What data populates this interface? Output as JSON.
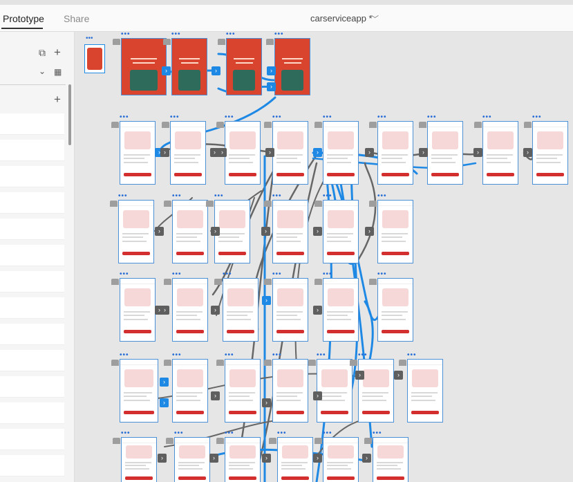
{
  "tabs": [
    {
      "label": "Prototype",
      "active": true
    },
    {
      "label": "Share",
      "active": false
    }
  ],
  "document": {
    "title": "carserviceapp *"
  },
  "icons": {
    "chevron": "chevron-down-icon",
    "plus": "plus-icon",
    "grid": "grid-icon",
    "copy": "copy-icon"
  },
  "colors": {
    "accent": "#1e88e5",
    "brand": "#d32f2f",
    "wire": "#666666"
  }
}
